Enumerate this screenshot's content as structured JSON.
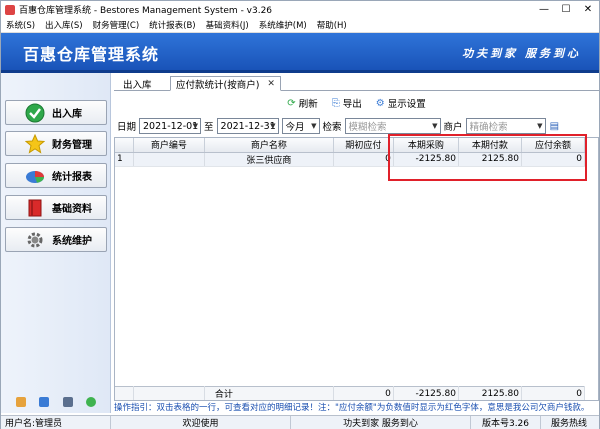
{
  "window": {
    "title": "百惠仓库管理系统 - Bestores Management System - v3.26"
  },
  "menu": [
    "系统(S)",
    "出入库(S)",
    "财务管理(C)",
    "统计报表(B)",
    "基础资料(J)",
    "系统维护(M)",
    "帮助(H)"
  ],
  "banner": {
    "title": "百惠仓库管理系统",
    "slogan": "功夫到家 服务到心"
  },
  "sidebar": [
    {
      "label": "出入库",
      "icon": "check-icon"
    },
    {
      "label": "财务管理",
      "icon": "star-icon"
    },
    {
      "label": "统计报表",
      "icon": "pie-chart-icon"
    },
    {
      "label": "基础资料",
      "icon": "book-icon"
    },
    {
      "label": "系统维护",
      "icon": "gear-icon"
    }
  ],
  "tabs": [
    {
      "label": "出入库"
    },
    {
      "label": "应付款统计(按商户)"
    }
  ],
  "toolbar": {
    "refresh": "刷新",
    "export": "导出",
    "display": "显示设置"
  },
  "filter": {
    "date_label": "日期",
    "date_from": "2021-12-01",
    "to_label": "至",
    "date_to": "2021-12-31",
    "period": "今月",
    "search_label": "检索",
    "search_placeholder": "模糊检索",
    "merchant_label": "商户",
    "merchant_placeholder": "精确检索"
  },
  "grid": {
    "columns": [
      "",
      "商户编号",
      "商户名称",
      "期初应付",
      "本期采购",
      "本期付款",
      "应付余额"
    ],
    "rows": [
      [
        "1",
        "",
        "张三供应商",
        "0",
        "-2125.80",
        "2125.80",
        "0"
      ]
    ],
    "total": [
      "",
      "",
      "合计",
      "0",
      "-2125.80",
      "2125.80",
      "0"
    ]
  },
  "hint": "操作指引：双击表格的一行，可查看对应的明细记录！注：\"应付余额\"为负数值时显示为红色字体，意思是我公司欠商户钱款。",
  "status": {
    "user": "用户名:管理员",
    "welcome": "欢迎使用",
    "slogan": "功夫到家 服务到心",
    "version": "版本号3.26",
    "service": "服务热线"
  }
}
